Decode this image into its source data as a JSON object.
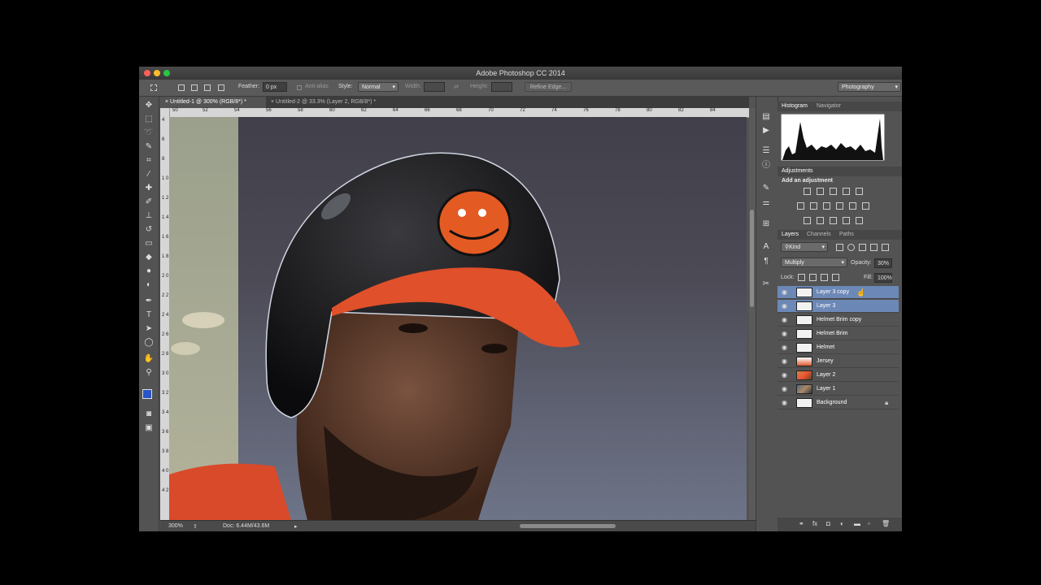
{
  "window": {
    "title": "Adobe Photoshop CC 2014"
  },
  "options_bar": {
    "feather_label": "Feather:",
    "feather_value": "0 px",
    "anti_alias_label": "Anti-alias",
    "style_label": "Style:",
    "style_value": "Normal",
    "width_label": "Width:",
    "height_label": "Height:",
    "refine_edge_label": "Refine Edge...",
    "workspace_value": "Photography"
  },
  "tabs": [
    {
      "label": "Untitled-1 @ 300% (RGB/8*) *"
    },
    {
      "label": "Untitled-2 @ 33.3% (Layer 2, RGB/8*) *"
    }
  ],
  "ruler": {
    "h_ticks": [
      "50",
      "52",
      "54",
      "56",
      "58",
      "60",
      "62",
      "64",
      "66",
      "68",
      "70",
      "72",
      "74",
      "76",
      "78",
      "80",
      "82",
      "84"
    ],
    "v_ticks": [
      "4",
      "6",
      "8",
      "1 0",
      "1 2",
      "1 4",
      "1 6",
      "1 8",
      "2 0",
      "2 2",
      "2 4",
      "2 6",
      "2 8",
      "3 0",
      "3 2",
      "3 4",
      "3 6",
      "3 8",
      "4 0",
      "4 2"
    ]
  },
  "status": {
    "zoom": "300%",
    "doc": "Doc: 6.44M/43.6M"
  },
  "panels": {
    "histogram_tab": "Histogram",
    "navigator_tab": "Navigator",
    "adjustments_tab": "Adjustments",
    "add_adjustment": "Add an adjustment",
    "layers_tab": "Layers",
    "channels_tab": "Channels",
    "paths_tab": "Paths",
    "kind_label": "Kind",
    "blend_mode": "Multiply",
    "opacity_label": "Opacity:",
    "opacity_value": "30%",
    "lock_label": "Lock:",
    "fill_label": "Fill:",
    "fill_value": "100%"
  },
  "layers": [
    {
      "name": "Layer 3 copy",
      "selected": true
    },
    {
      "name": "Layer 3",
      "selected": true
    },
    {
      "name": "Helmet Brim copy",
      "selected": false
    },
    {
      "name": "Helmet Brim",
      "selected": false
    },
    {
      "name": "Helmet",
      "selected": false
    },
    {
      "name": "Jersey",
      "selected": false
    },
    {
      "name": "Layer 2",
      "selected": false
    },
    {
      "name": "Layer 1",
      "selected": false
    },
    {
      "name": "Background",
      "selected": false
    }
  ],
  "colors": {
    "selection": "#6c88b6",
    "helmet_brim": "#e0502a",
    "jersey": "#d94a2a"
  }
}
